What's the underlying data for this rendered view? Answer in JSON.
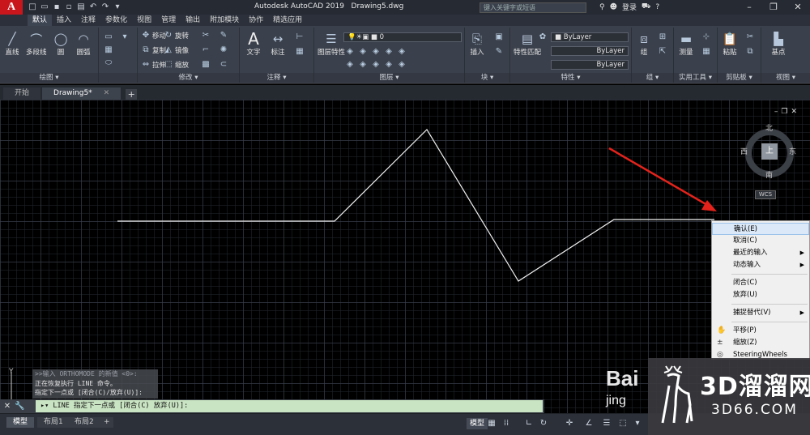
{
  "app": {
    "title": "Autodesk AutoCAD 2019",
    "file": "Drawing5.dwg",
    "logo": "A",
    "search_placeholder": "键入关键字或短语",
    "user": "登录"
  },
  "menubar": [
    "默认",
    "插入",
    "注释",
    "参数化",
    "视图",
    "管理",
    "输出",
    "附加模块",
    "协作",
    "精选应用"
  ],
  "ribbon": {
    "draw": {
      "title": "绘图",
      "tools": [
        "直线",
        "多段线",
        "圆",
        "圆弧"
      ]
    },
    "modify": {
      "title": "修改",
      "tools": [
        "移动",
        "旋转",
        "复制",
        "镜像",
        "拉伸",
        "缩放"
      ]
    },
    "annotation": {
      "title": "注释",
      "tools": [
        "文字",
        "标注"
      ]
    },
    "layers": {
      "title": "图层",
      "tools": [
        "图层特性"
      ],
      "current_layer": "0"
    },
    "block": {
      "title": "块",
      "tools": [
        "插入"
      ]
    },
    "properties": {
      "title": "特性",
      "tools": [
        "特性匹配"
      ],
      "bylayer": "ByLayer"
    },
    "groups": {
      "title": "组",
      "tools": [
        "组"
      ]
    },
    "utilities": {
      "title": "实用工具",
      "tools": [
        "测量"
      ]
    },
    "clipboard": {
      "title": "剪贴板",
      "tools": [
        "粘贴"
      ]
    },
    "view": {
      "title": "视图",
      "tools": [
        "基点"
      ]
    }
  },
  "filetabs": [
    "开始",
    "Drawing5*"
  ],
  "viewcube": {
    "north": "北",
    "south": "南",
    "east": "东",
    "west": "西",
    "top": "上",
    "wcs": "WCS"
  },
  "context_menu": [
    "确认(E)",
    "取消(C)",
    "最近的输入",
    "动态输入",
    "闭合(C)",
    "放弃(U)",
    "捕捉替代(V)",
    "平移(P)",
    "缩放(Z)",
    "SteeringWheels"
  ],
  "command_history": [
    ">>输入 ORTHOMODE 的新值 <0>:",
    "正在恢复执行 LINE 命令。",
    "指定下一点或 [闭合(C)/放弃(U)]:"
  ],
  "command_prompt": "LINE 指定下一点或 [闭合(C) 放弃(U)]:",
  "layout_tabs": [
    "模型",
    "布局1",
    "布局2"
  ],
  "status": {
    "model": "模型"
  },
  "watermark": {
    "brand": "3D溜溜网",
    "domain": "3D66.COM",
    "baidu": "Bai",
    "baidu2": "jing"
  }
}
